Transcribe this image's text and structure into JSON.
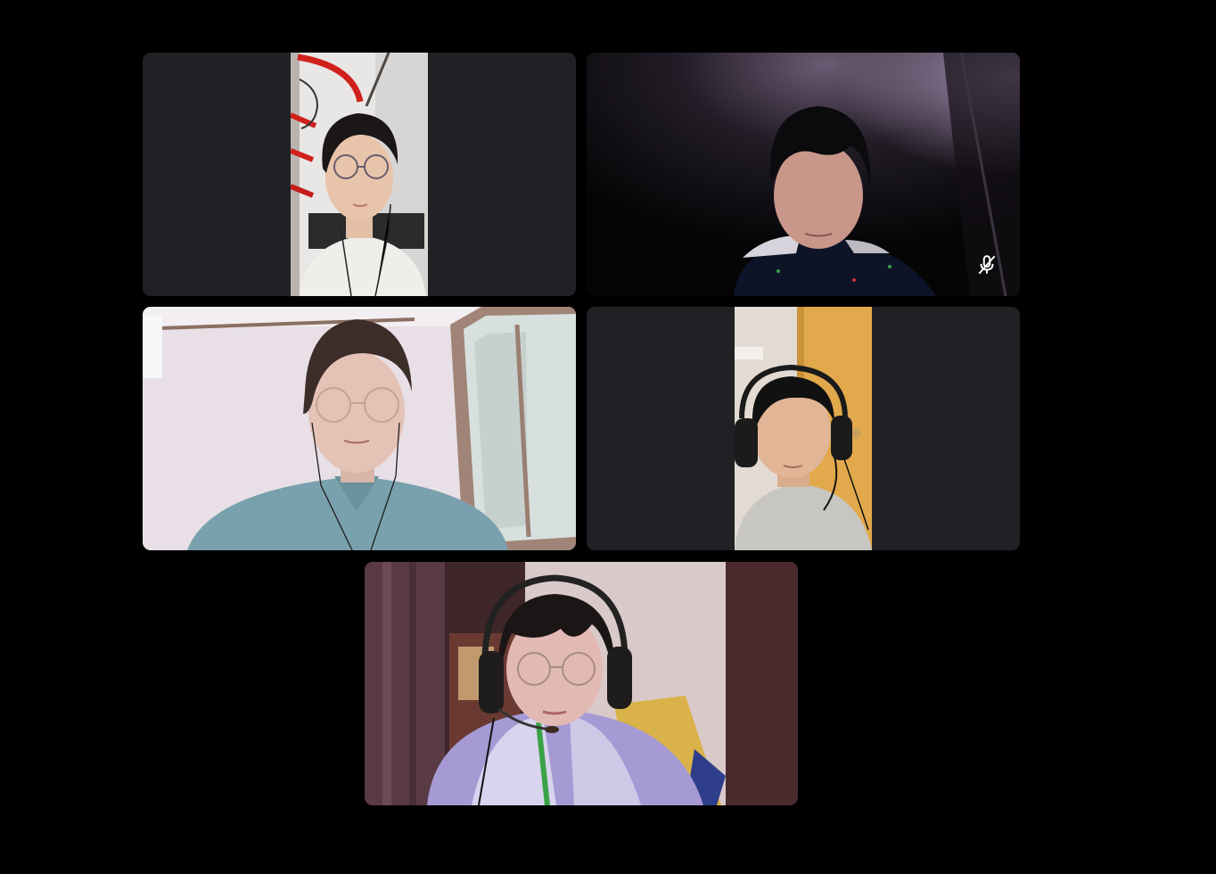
{
  "meeting": {
    "background_color": "#000000",
    "tile_background_color": "#202124",
    "participants": [
      {
        "video": "portrait",
        "muted": false
      },
      {
        "video": "landscape",
        "muted": true,
        "indicator_icon": "mic-off-icon"
      },
      {
        "video": "landscape",
        "muted": false
      },
      {
        "video": "portrait",
        "muted": false
      },
      {
        "video": "landscape",
        "muted": false
      }
    ]
  }
}
